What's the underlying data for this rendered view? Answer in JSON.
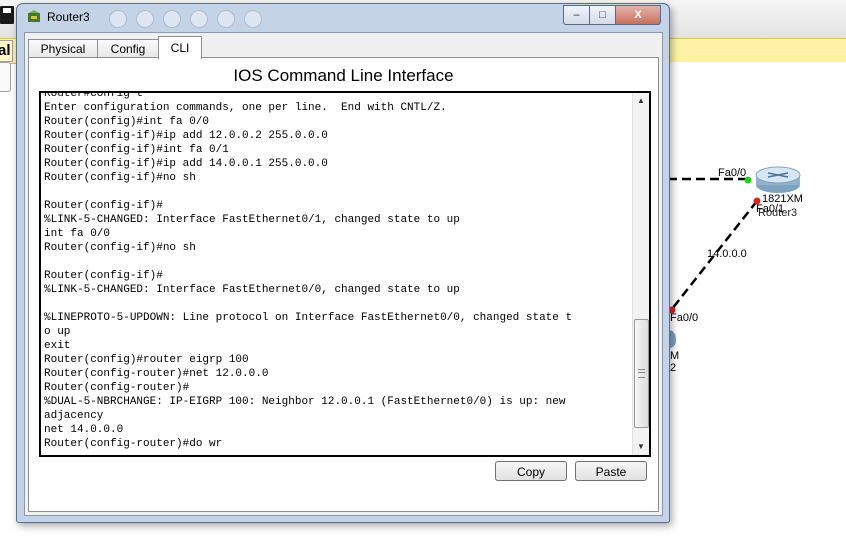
{
  "background_app": {
    "left_tab_label": "al",
    "topology": {
      "router_label_model": "1821XM",
      "router_name": "Router3",
      "interfaces": [
        "Fa0/0",
        "Fa0/1",
        "Fa0/0"
      ],
      "network_label": "14.0.0.0",
      "partial_device_label_1": "M",
      "partial_device_label_2": "2",
      "link_up_color": "#22cc22",
      "link_down_color": "#dd2222"
    }
  },
  "window": {
    "title": "Router3",
    "controls": {
      "minimize": "–",
      "maximize": "□",
      "close": "X"
    },
    "tabs": [
      {
        "label": "Physical",
        "selected": false
      },
      {
        "label": "Config",
        "selected": false
      },
      {
        "label": "CLI",
        "selected": true
      }
    ],
    "cli_heading": "IOS Command Line Interface",
    "terminal_lines": [
      "Router#config t",
      "Enter configuration commands, one per line.  End with CNTL/Z.",
      "Router(config)#int fa 0/0",
      "Router(config-if)#ip add 12.0.0.2 255.0.0.0",
      "Router(config-if)#int fa 0/1",
      "Router(config-if)#ip add 14.0.0.1 255.0.0.0",
      "Router(config-if)#no sh",
      "",
      "Router(config-if)#",
      "%LINK-5-CHANGED: Interface FastEthernet0/1, changed state to up",
      "int fa 0/0",
      "Router(config-if)#no sh",
      "",
      "Router(config-if)#",
      "%LINK-5-CHANGED: Interface FastEthernet0/0, changed state to up",
      "",
      "%LINEPROTO-5-UPDOWN: Line protocol on Interface FastEthernet0/0, changed state t",
      "o up",
      "exit",
      "Router(config)#router eigrp 100",
      "Router(config-router)#net 12.0.0.0",
      "Router(config-router)#",
      "%DUAL-5-NBRCHANGE: IP-EIGRP 100: Neighbor 12.0.0.1 (FastEthernet0/0) is up: new",
      "adjacency",
      "net 14.0.0.0",
      "Router(config-router)#do wr"
    ],
    "scrollbar": {
      "thumb_start": 0.635,
      "thumb_end": 0.96
    },
    "buttons": {
      "copy": "Copy",
      "paste": "Paste"
    }
  }
}
